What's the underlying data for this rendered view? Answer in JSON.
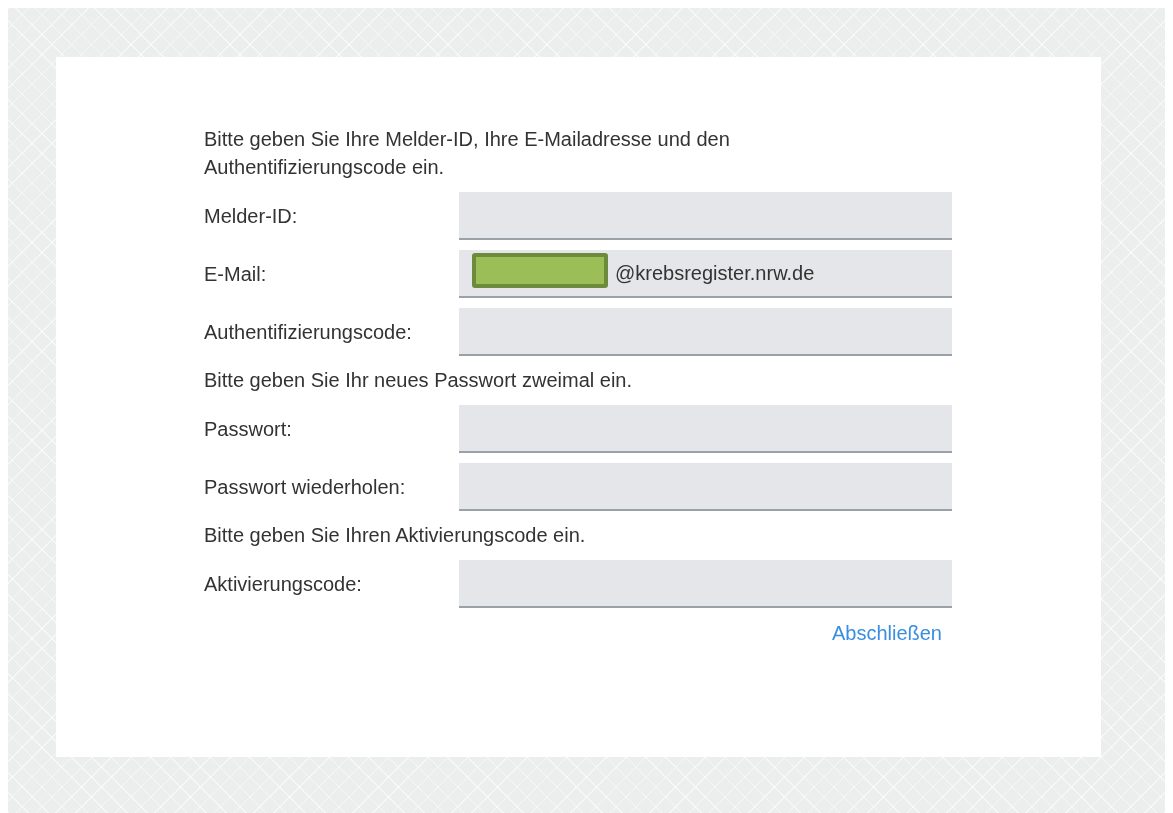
{
  "form": {
    "items": [
      {
        "kind": "instruction",
        "text": "Bitte geben Sie Ihre Melder-ID, Ihre E-Mailadresse und den Authentifizierungscode ein."
      },
      {
        "kind": "field",
        "label": "Melder-ID:"
      },
      {
        "kind": "field",
        "label": "E-Mail:",
        "value": "@krebsregister.nrw.de",
        "redacted": true
      },
      {
        "kind": "field",
        "label": "Authentifizierungscode:"
      },
      {
        "kind": "instruction",
        "text": "Bitte geben Sie Ihr neues Passwort zweimal ein."
      },
      {
        "kind": "field",
        "label": "Passwort:"
      },
      {
        "kind": "field",
        "label": "Passwort wiederholen:"
      },
      {
        "kind": "instruction",
        "text": "Bitte geben Sie Ihren Aktivierungscode ein."
      },
      {
        "kind": "field",
        "label": "Aktivierungscode:"
      }
    ],
    "submit": "Abschließen"
  }
}
